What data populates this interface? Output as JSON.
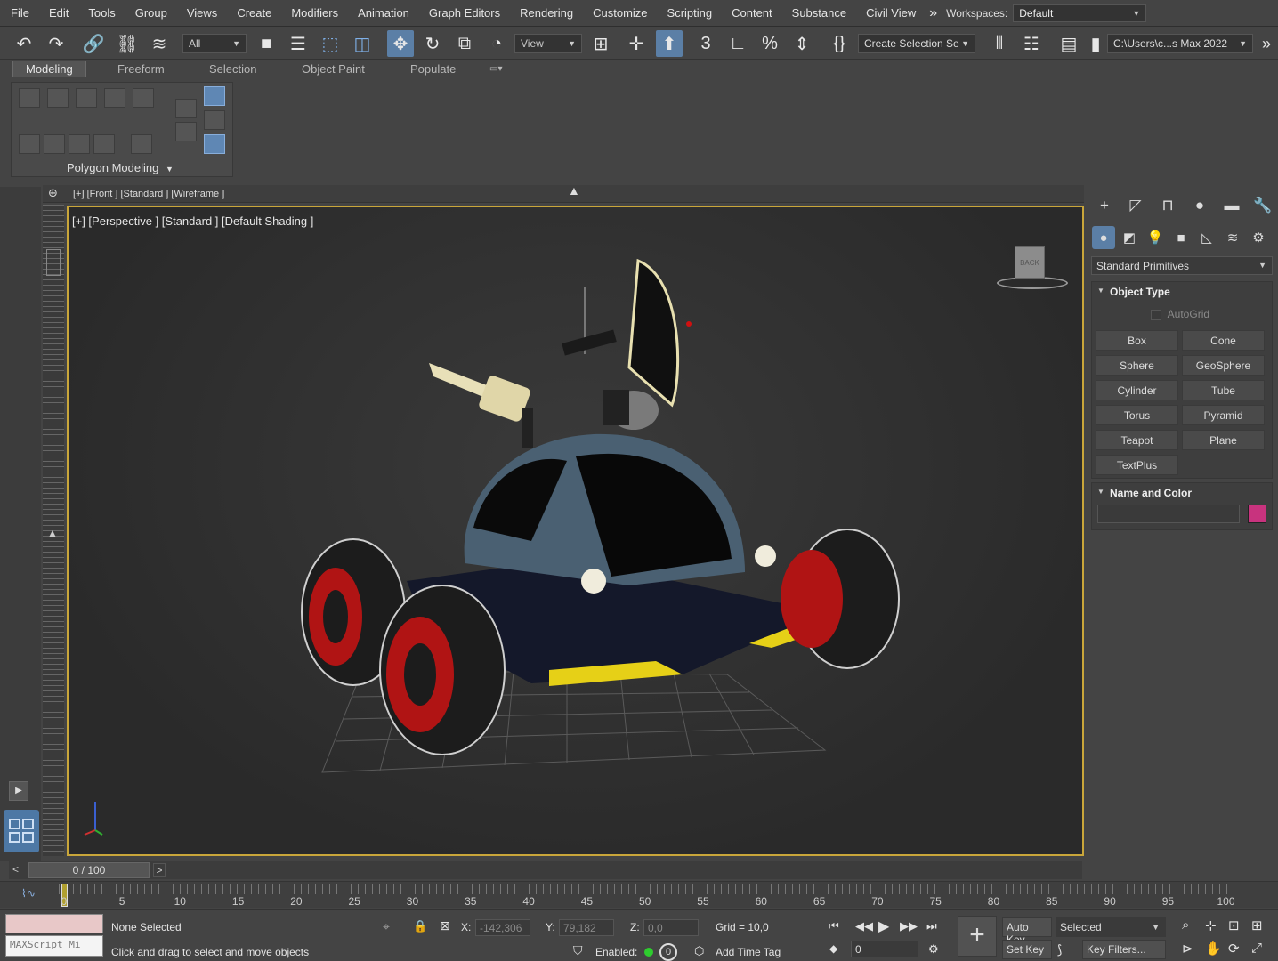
{
  "menu": {
    "items": [
      "File",
      "Edit",
      "Tools",
      "Group",
      "Views",
      "Create",
      "Modifiers",
      "Animation",
      "Graph Editors",
      "Rendering",
      "Customize",
      "Scripting",
      "Content",
      "Substance",
      "Civil View"
    ],
    "overflow": "»",
    "workspaces_label": "Workspaces:",
    "workspace_value": "Default"
  },
  "toolbar": {
    "selection_filter": "All",
    "ref_coord": "View",
    "named_selection": "Create Selection Se",
    "project_path": "C:\\Users\\c...s Max 2022"
  },
  "ribbon": {
    "tabs": [
      "Modeling",
      "Freeform",
      "Selection",
      "Object Paint",
      "Populate"
    ],
    "panel_label": "Polygon Modeling"
  },
  "viewport": {
    "top_label": "[+] [Front ] [Standard ] [Wireframe ]",
    "label": "[+] [Perspective ] [Standard ] [Default Shading ]",
    "viewcube_face": "BACK"
  },
  "command_panel": {
    "category": "Standard Primitives",
    "object_type_title": "Object Type",
    "autogrid": "AutoGrid",
    "primitives": [
      "Box",
      "Cone",
      "Sphere",
      "GeoSphere",
      "Cylinder",
      "Tube",
      "Torus",
      "Pyramid",
      "Teapot",
      "Plane",
      "TextPlus"
    ],
    "name_color_title": "Name and Color",
    "color": "#c8337e"
  },
  "timeline": {
    "position": "0 / 100",
    "frames": [
      "0",
      "5",
      "10",
      "15",
      "20",
      "25",
      "30",
      "35",
      "40",
      "45",
      "50",
      "55",
      "60",
      "65",
      "70",
      "75",
      "80",
      "85",
      "90",
      "95",
      "100"
    ]
  },
  "status": {
    "maxscript": "MAXScript Mi",
    "selection": "None Selected",
    "prompt": "Click and drag to select and move objects",
    "x_label": "X:",
    "x_value": "-142,306",
    "y_label": "Y:",
    "y_value": "79,182",
    "z_label": "Z:",
    "z_value": "0,0",
    "grid": "Grid = 10,0",
    "enabled": "Enabled:",
    "add_time_tag": "Add Time Tag",
    "auto_key": "Auto Key",
    "set_key": "Set Key",
    "key_mode": "Selected",
    "key_filters": "Key Filters...",
    "frame_field": "0"
  }
}
